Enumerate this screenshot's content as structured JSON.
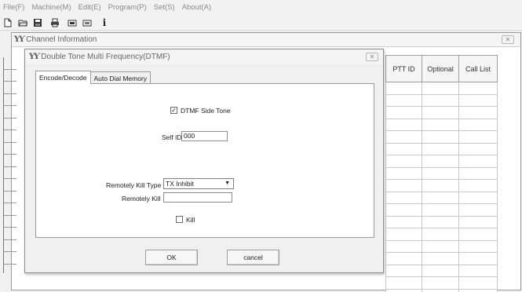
{
  "menu": [
    "File(F)",
    "Machine(M)",
    "Edit(E)",
    "Program(P)",
    "Set(S)",
    "About(A)"
  ],
  "toolbar_icons": [
    "new-file-icon",
    "open-folder-icon",
    "save-icon",
    "print-icon",
    "read-radio-icon",
    "write-radio-icon",
    "info-icon"
  ],
  "info_glyph": "i",
  "channel_window": {
    "title": "Channel Information",
    "logo": "ƳƳ",
    "close": "✕",
    "columns": [
      "PTT ID",
      "Optional",
      "Call List"
    ],
    "row_count": 18
  },
  "dtmf_dialog": {
    "title": "Double Tone Multi Frequency(DTMF)",
    "logo": "ƳƳ",
    "close": "✕",
    "tabs": [
      "Encode/Decode",
      "Auto Dial Memory"
    ],
    "side_tone_label": "DTMF Side Tone",
    "side_tone_checked": "✓",
    "self_id_label": "Self ID",
    "self_id_value": "000",
    "kill_type_label": "Remotely Kill Type",
    "kill_type_value": "TX Inhibit",
    "kill_type_arrow": "▼",
    "remotely_kill_label": "Remotely Kill",
    "remotely_kill_value": "",
    "kill_label": "Kill",
    "ok_label": "OK",
    "cancel_label": "cancel"
  }
}
